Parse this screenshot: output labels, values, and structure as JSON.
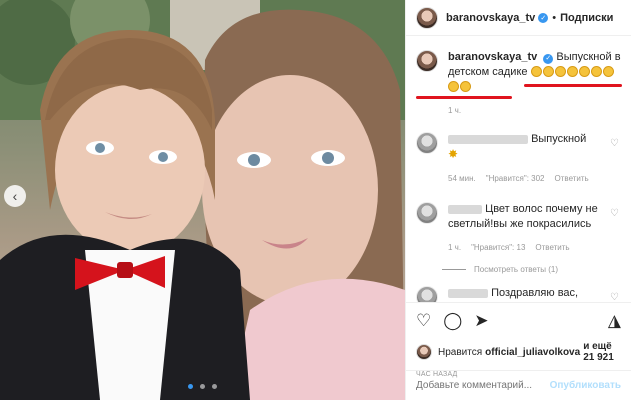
{
  "post": {
    "image_alt": "Boy in a black suit with a red bow tie and a woman with light brown hair, selfie outdoors",
    "slide_count": 3,
    "active_slide": 1
  },
  "header": {
    "username": "baranovskaya_tv",
    "separator": "•",
    "follow_label": "Подписки"
  },
  "caption": {
    "username": "baranovskaya_tv",
    "text": "Выпускной в детском садике",
    "emoji_count": 9,
    "time": "1 ч."
  },
  "comments": [
    {
      "username_hidden": true,
      "text": "Выпускной",
      "time": "54 мин.",
      "likes": "\"Нравится\": 302",
      "reply": "Ответить"
    },
    {
      "username_hidden": true,
      "text": "Цвет волос почему не светлый!вы же покрасились",
      "time": "1 ч.",
      "likes": "\"Нравится\": 13",
      "reply": "Ответить",
      "view_replies": "Посмотреть ответы (1)"
    },
    {
      "username_hidden": true,
      "text": "Поздравляю вас,"
    }
  ],
  "actions": {
    "liked_by_prefix": "Нравится",
    "liked_by_user": "official_juliavolkova",
    "liked_by_suffix": "и ещё 21 921",
    "timestamp": "ЧАС НАЗАД"
  },
  "add_comment": {
    "placeholder": "Добавьте комментарий...",
    "publish_label": "Опубликовать"
  },
  "colors": {
    "accent": "#3897f0",
    "annotation_red": "#e0141e",
    "muted": "#999999"
  }
}
